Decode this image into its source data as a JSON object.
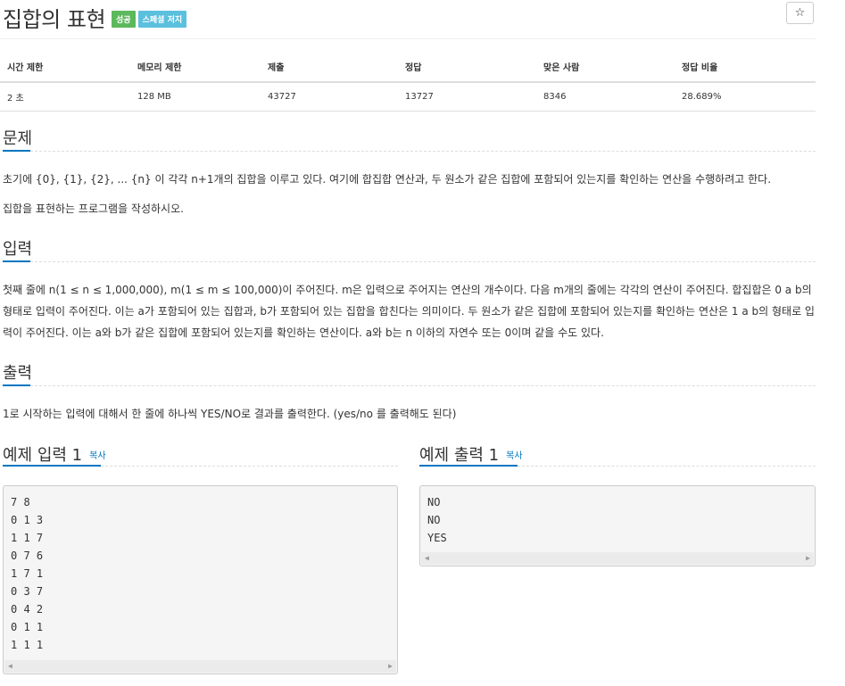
{
  "header": {
    "title": "집합의 표현",
    "badge_success": "성공",
    "badge_info": "스페셜 저지",
    "star_icon": "☆"
  },
  "info_table": {
    "headers": [
      "시간 제한",
      "메모리 제한",
      "제출",
      "정답",
      "맞은 사람",
      "정답 비율"
    ],
    "values": [
      "2 초",
      "128 MB",
      "43727",
      "13727",
      "8346",
      "28.689%"
    ]
  },
  "problem": {
    "heading": "문제",
    "lines": [
      "초기에 {0}, {1}, {2}, ... {n} 이 각각 n+1개의 집합을 이루고 있다. 여기에 합집합 연산과, 두 원소가 같은 집합에 포함되어 있는지를 확인하는 연산을 수행하려고 한다.",
      "집합을 표현하는 프로그램을 작성하시오."
    ]
  },
  "input": {
    "heading": "입력",
    "text": "첫째 줄에 n(1 ≤ n ≤ 1,000,000), m(1 ≤ m ≤ 100,000)이 주어진다. m은 입력으로 주어지는 연산의 개수이다. 다음 m개의 줄에는 각각의 연산이 주어진다. 합집합은 0 a b의 형태로 입력이 주어진다. 이는 a가 포함되어 있는 집합과, b가 포함되어 있는 집합을 합친다는 의미이다. 두 원소가 같은 집합에 포함되어 있는지를 확인하는 연산은 1 a b의 형태로 입력이 주어진다. 이는 a와 b가 같은 집합에 포함되어 있는지를 확인하는 연산이다. a와 b는 n 이하의 자연수 또는 0이며 같을 수도 있다."
  },
  "output": {
    "heading": "출력",
    "text": "1로 시작하는 입력에 대해서 한 줄에 하나씩 YES/NO로 결과를 출력한다. (yes/no 를 출력해도 된다)"
  },
  "sample_input": {
    "heading": "예제 입력 1",
    "copy_label": "복사",
    "lines": [
      "7 8",
      "0 1 3",
      "1 1 7",
      "0 7 6",
      "1 7 1",
      "0 3 7",
      "0 4 2",
      "0 1 1",
      "1 1 1"
    ]
  },
  "sample_output": {
    "heading": "예제 출력 1",
    "copy_label": "복사",
    "lines": [
      "NO",
      "NO",
      "YES"
    ]
  },
  "scroll": {
    "left_arrow": "◀",
    "right_arrow": "▶"
  },
  "colors": {
    "success": "#5cb85c",
    "info": "#5bc0de",
    "accent": "#0076c0"
  }
}
